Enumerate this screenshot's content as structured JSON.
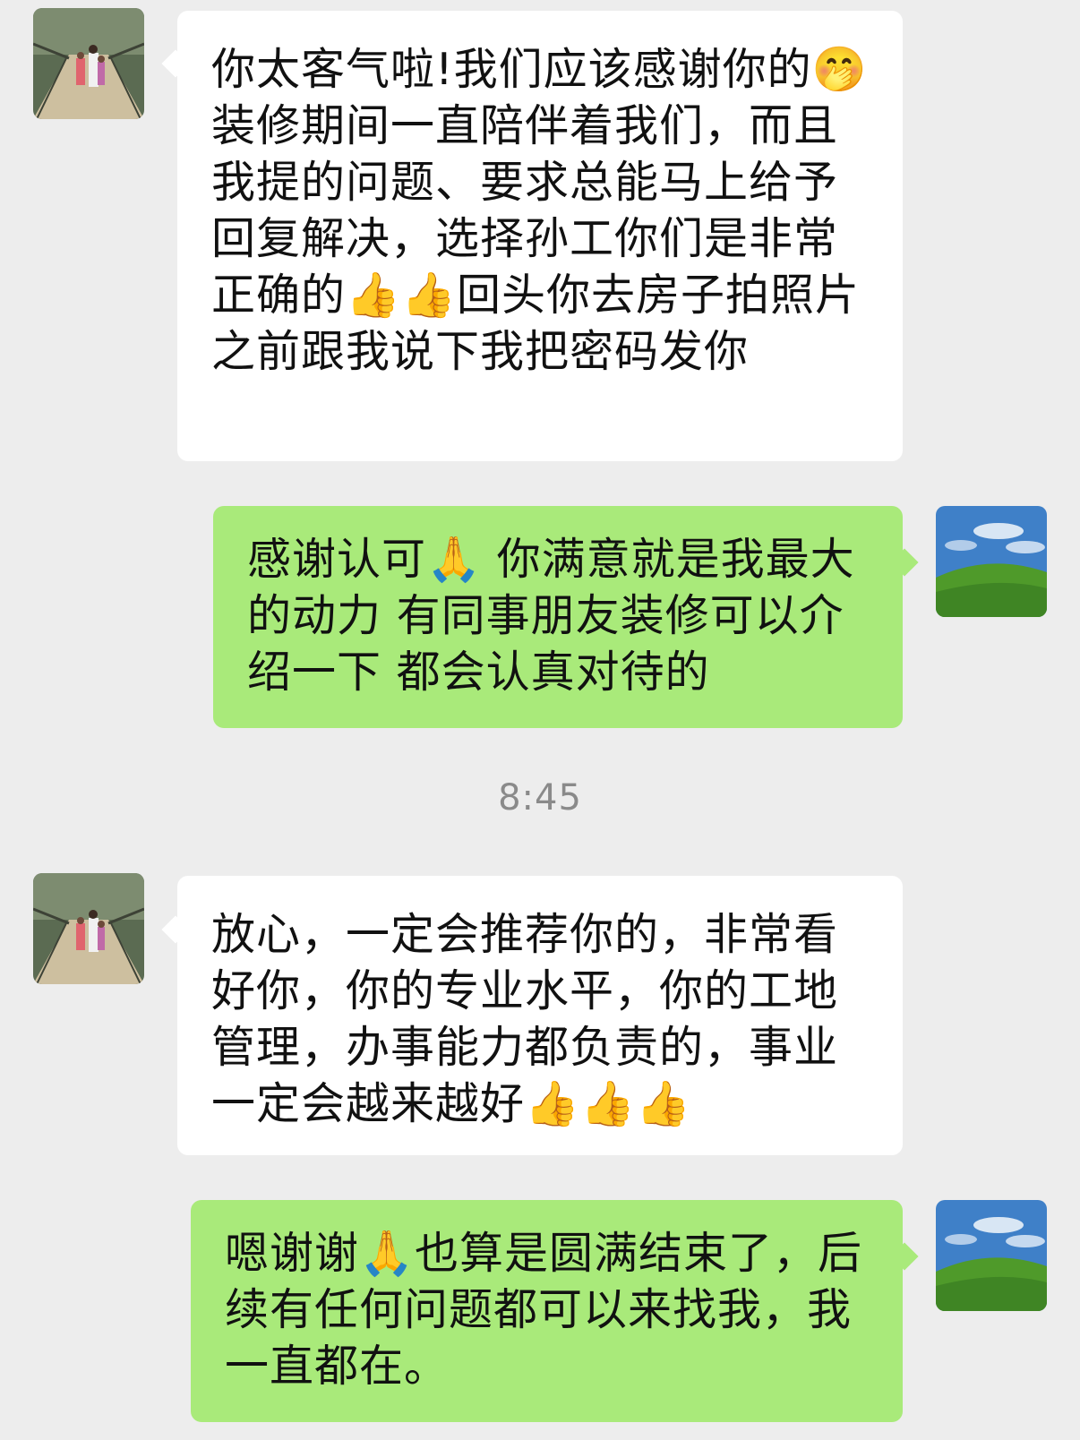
{
  "messages": [
    {
      "side": "received",
      "text": "你太客气啦!我们应该感谢你的🤭 装修期间一直陪伴着我们，而且我提的问题、要求总能马上给予回复解决，选择孙工你们是非常正确的👍👍回头你去房子拍照片之前跟我说下我把密码发你"
    },
    {
      "side": "sent",
      "text": "感谢认可🙏 你满意就是我最大的动力 有同事朋友装修可以介绍一下 都会认真对待的"
    },
    {
      "side": "received",
      "text": "放心，一定会推荐你的，非常看好你，你的专业水平，你的工地管理，办事能力都负责的，事业一定会越来越好👍👍👍"
    },
    {
      "side": "sent",
      "text": "嗯谢谢🙏也算是圆满结束了，后续有任何问题都可以来找我，我一直都在。"
    }
  ],
  "timestamp": "8:45",
  "avatars": {
    "received": "bridge-family-photo-avatar",
    "sent": "green-hill-blue-sky-avatar"
  },
  "colors": {
    "background": "#ededed",
    "received_bubble": "#ffffff",
    "sent_bubble": "#a9ea7a",
    "timestamp_text": "#8a8a8a"
  }
}
